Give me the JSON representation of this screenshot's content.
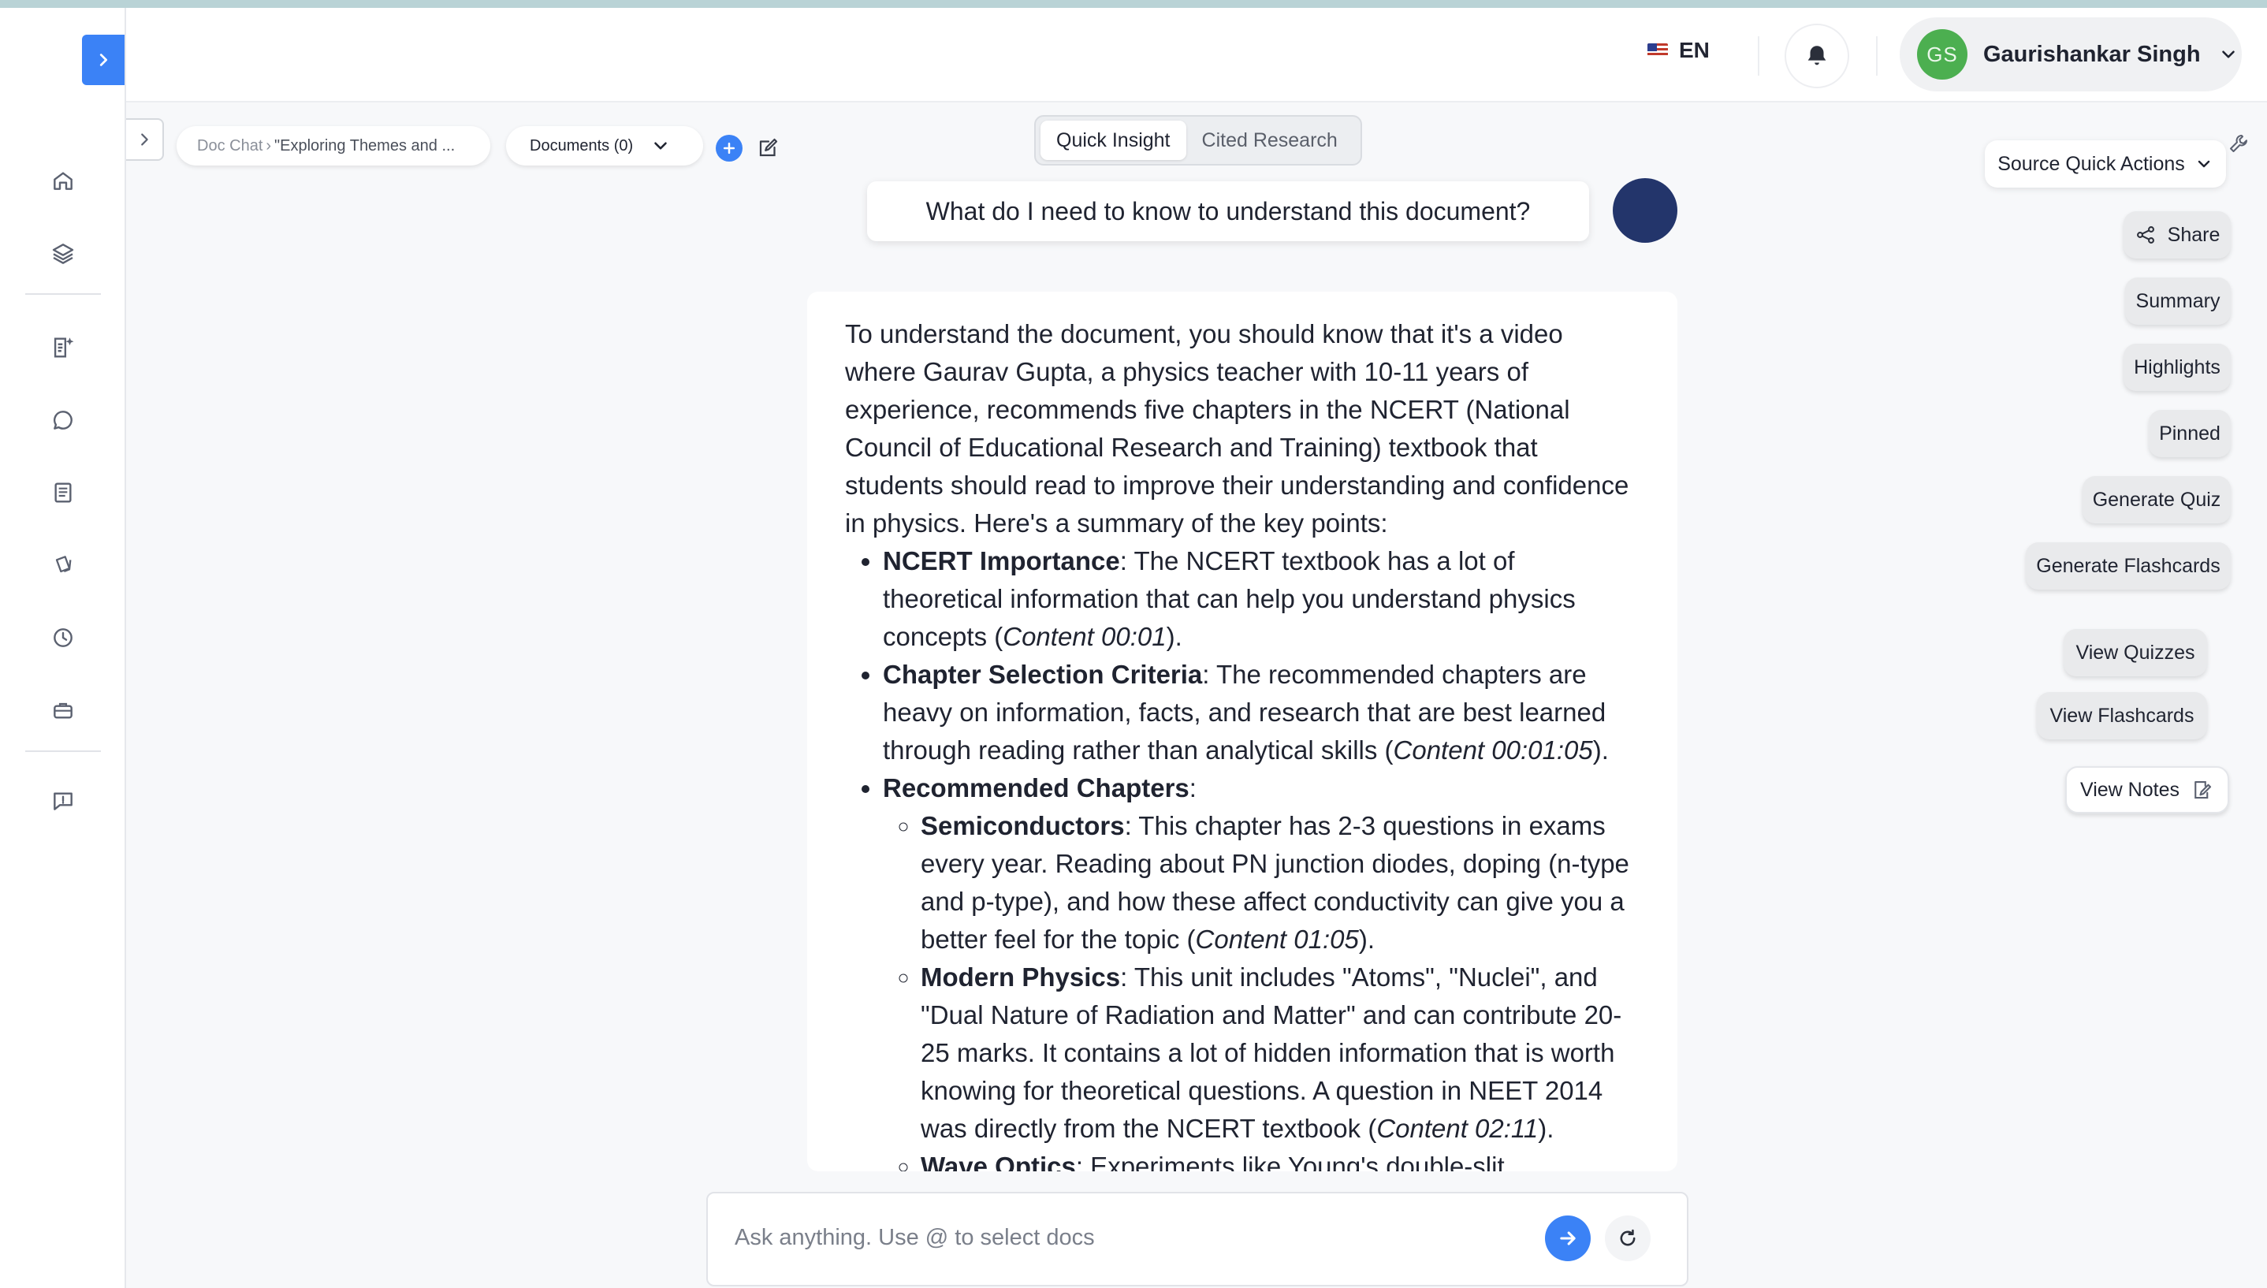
{
  "header": {
    "language": "EN",
    "user": {
      "initials": "GS",
      "name": "Gaurishankar Singh"
    }
  },
  "icons": {
    "rail": [
      "home-icon",
      "layers-icon",
      "ai-document-icon",
      "chat-icon",
      "notes-icon",
      "flashcards-icon",
      "history-icon",
      "briefcase-icon",
      "feedback-icon"
    ],
    "header": [
      "flag-us-icon",
      "bell-icon",
      "chevron-down-icon"
    ]
  },
  "colors": {
    "accent": "#3b82f6",
    "avatar_green": "#4caf50",
    "user_avatar": "#23356b"
  },
  "toolbar": {
    "breadcrumb_root": "Doc Chat",
    "breadcrumb_sep": "›",
    "breadcrumb_current": "\"Exploring Themes and ...",
    "documents_label": "Documents (0)"
  },
  "modes": {
    "quick": "Quick Insight",
    "cited": "Cited Research",
    "active": "quick"
  },
  "chat": {
    "question": "What do I need to know to understand this document?",
    "answer": {
      "intro": "To understand the document, you should know that it's a video where Gaurav Gupta, a physics teacher with 10-11 years of experience, recommends five chapters in the NCERT (National Council of Educational Research and Training) textbook that students should read to improve their understanding and confidence in physics. Here's a summary of the key points:",
      "points": [
        {
          "title": "NCERT Importance",
          "text": ": The NCERT textbook has a lot of theoretical information that can help you understand physics concepts (",
          "cite": "Content 00:01",
          "end": ")."
        },
        {
          "title": "Chapter Selection Criteria",
          "text": ": The recommended chapters are heavy on information, facts, and research that are best learned through reading rather than analytical skills (",
          "cite": "Content 00:01:05",
          "end": ")."
        },
        {
          "title": "Recommended Chapters",
          "text": ":"
        }
      ],
      "chapters": [
        {
          "title": "Semiconductors",
          "text": ": This chapter has 2-3 questions in exams every year. Reading about PN junction diodes, doping (n-type and p-type), and how these affect conductivity can give you a better feel for the topic (",
          "cite": "Content 01:05",
          "end": ")."
        },
        {
          "title": "Modern Physics",
          "text": ": This unit includes \"Atoms\", \"Nuclei\", and \"Dual Nature of Radiation and Matter\" and can contribute 20-25 marks. It contains a lot of hidden information that is worth knowing for theoretical questions. A question in NEET 2014 was directly from the NCERT textbook (",
          "cite": "Content 02:11",
          "end": ")."
        },
        {
          "title": "Wave Optics",
          "text": ": Experiments like Young's double-slit"
        }
      ]
    }
  },
  "input": {
    "placeholder": "Ask anything. Use @ to select docs"
  },
  "actions": {
    "source_quick_actions": "Source Quick Actions",
    "share": "Share",
    "summary": "Summary",
    "highlights": "Highlights",
    "pinned": "Pinned",
    "generate_quiz": "Generate Quiz",
    "generate_flashcards": "Generate Flashcards",
    "view_quizzes": "View Quizzes",
    "view_flashcards": "View Flashcards",
    "view_notes": "View Notes"
  }
}
